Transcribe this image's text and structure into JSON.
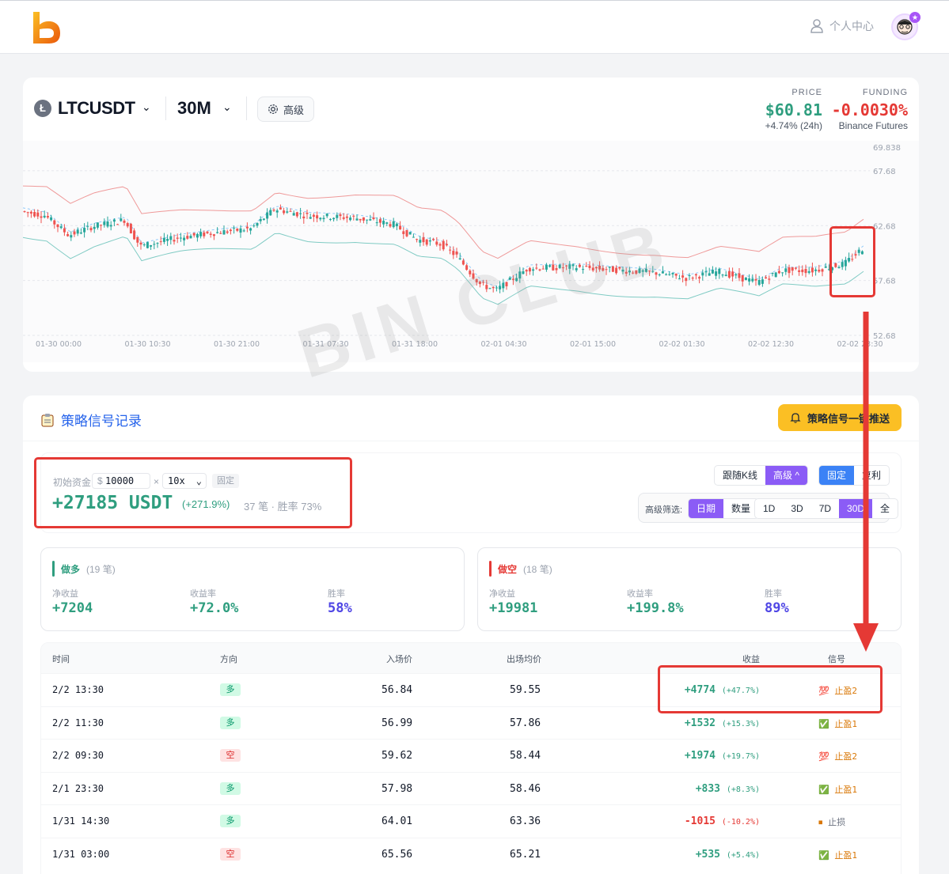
{
  "header": {
    "user_center_label": "个人中心"
  },
  "chart_header": {
    "symbol": "LTCUSDT",
    "interval": "30M",
    "advanced_label": "高级",
    "price_label": "PRICE",
    "price_value": "$60.81",
    "price_change": "+4.74% (24h)",
    "funding_label": "FUNDING",
    "funding_value": "-0.0030%",
    "funding_source": "Binance Futures"
  },
  "watermark": "BIN CLUB",
  "chart_data": {
    "type": "candlestick",
    "title": "",
    "y_ticks": [
      "69.838",
      "67.68",
      "62.68",
      "57.68",
      "52.68"
    ],
    "x_ticks": [
      "01-30 00:00",
      "01-30 10:30",
      "01-30 21:00",
      "01-31 07:30",
      "01-31 18:00",
      "02-01 04:30",
      "02-01 15:00",
      "02-02 01:30",
      "02-02 12:30",
      "02-02 23:30"
    ],
    "ylim": [
      52.68,
      69.838
    ],
    "indicators": [
      "upper band",
      "lower band",
      "middle band (dashed)"
    ],
    "colors": {
      "up": "#26a69a",
      "down": "#ef5350",
      "upper_band": "#ef9a9a",
      "lower_band": "#80cbc4",
      "middle_band": "#90caf9"
    }
  },
  "records": {
    "title": "策略信号记录",
    "push_button": "策略信号一键推送",
    "initial_capital_label": "初始资金",
    "capital_prefix": "$",
    "capital_value": "10000",
    "multiply_sign": "×",
    "leverage": "10x",
    "fixed_tag": "固定",
    "total_profit": "+27185 USDT",
    "total_pct": "(+271.9%)",
    "trade_summary": "37 笔 · 胜率 73%",
    "mode_buttons": [
      "跟随K线",
      "高级 ^",
      "固定",
      "复利"
    ],
    "filter_label": "高级筛选:",
    "filter_types": [
      "日期",
      "数量"
    ],
    "range_buttons": [
      "1D",
      "3D",
      "7D",
      "30D",
      "全部"
    ],
    "long": {
      "title": "做多",
      "count": "(19 笔)",
      "net_label": "净收益",
      "net_value": "+7204",
      "rate_label": "收益率",
      "rate_value": "+72.0%",
      "win_label": "胜率",
      "win_value": "58%"
    },
    "short": {
      "title": "做空",
      "count": "(18 笔)",
      "net_label": "净收益",
      "net_value": "+19981",
      "rate_label": "收益率",
      "rate_value": "+199.8%",
      "win_label": "胜率",
      "win_value": "89%"
    },
    "columns": [
      "时间",
      "方向",
      "入场价",
      "出场均价",
      "收益",
      "信号"
    ],
    "rows": [
      {
        "time": "2/2 13:30",
        "dir": "多",
        "entry": "56.84",
        "exit": "59.55",
        "profit": "+4774",
        "pct": "(+47.7%)",
        "signal_icon": "💯",
        "signal": "止盈2"
      },
      {
        "time": "2/2 11:30",
        "dir": "多",
        "entry": "56.99",
        "exit": "57.86",
        "profit": "+1532",
        "pct": "(+15.3%)",
        "signal_icon": "✅",
        "signal": "止盈1"
      },
      {
        "time": "2/2 09:30",
        "dir": "空",
        "entry": "59.62",
        "exit": "58.44",
        "profit": "+1974",
        "pct": "(+19.7%)",
        "signal_icon": "💯",
        "signal": "止盈2"
      },
      {
        "time": "2/1 23:30",
        "dir": "多",
        "entry": "57.98",
        "exit": "58.46",
        "profit": "+833",
        "pct": "(+8.3%)",
        "signal_icon": "✅",
        "signal": "止盈1"
      },
      {
        "time": "1/31 14:30",
        "dir": "多",
        "entry": "64.01",
        "exit": "63.36",
        "profit": "-1015",
        "pct": "(-10.2%)",
        "signal_icon": "⏹",
        "signal": "止损"
      },
      {
        "time": "1/31 03:00",
        "dir": "空",
        "entry": "65.56",
        "exit": "65.21",
        "profit": "+535",
        "pct": "(+5.4%)",
        "signal_icon": "✅",
        "signal": "止盈1"
      }
    ]
  }
}
